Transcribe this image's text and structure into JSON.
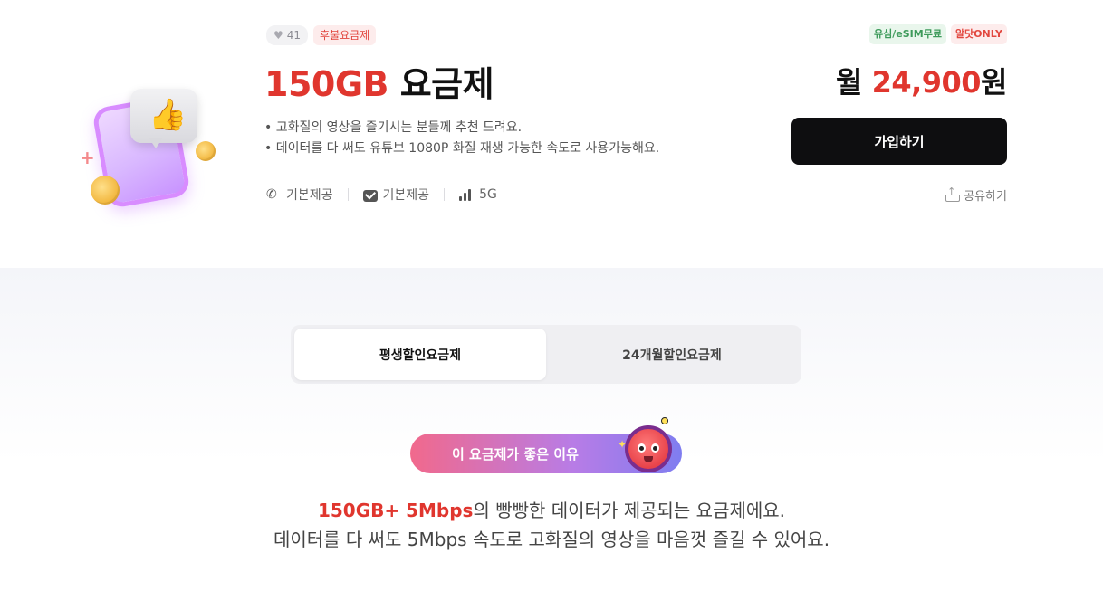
{
  "plan": {
    "likes": "41",
    "type_badge": "후불요금제",
    "title_highlight": "150GB",
    "title_rest": "요금제",
    "descriptions": [
      "• 고화질의 영상을 즐기시는 분들께 추천 드려요.",
      "• 데이터를 다 써도 유튜브 1080P 화질 재생 가능한 속도로 사용가능해요."
    ],
    "features": [
      "기본제공",
      "기본제공",
      "5G"
    ]
  },
  "pricing": {
    "badges": [
      "유심/eSIM무료",
      "알닷ONLY"
    ],
    "prefix": "월",
    "amount": "24,900",
    "suffix": "원",
    "join_label": "가입하기",
    "share_label": "공유하기"
  },
  "tabs": [
    {
      "label": "평생할인요금제",
      "active": true
    },
    {
      "label": "24개월할인요금제",
      "active": false
    }
  ],
  "reason": {
    "pill_label": "이 요금제가 좋은 이유",
    "line1_highlight": "150GB+ 5Mbps",
    "line1_rest": "의 빵빵한 데이터가 제공되는 요금제에요.",
    "line2": "데이터를 다 써도 5Mbps 속도로 고화질의 영상을 마음껏 즐길 수 있어요."
  },
  "colors": {
    "accent_red": "#e0362e",
    "button_dark": "#0e0e10",
    "esim_green": "#3d9a5a"
  },
  "icons": [
    "heart-icon",
    "phone-icon",
    "message-icon",
    "signal-icon",
    "share-icon",
    "mascot-icon"
  ]
}
